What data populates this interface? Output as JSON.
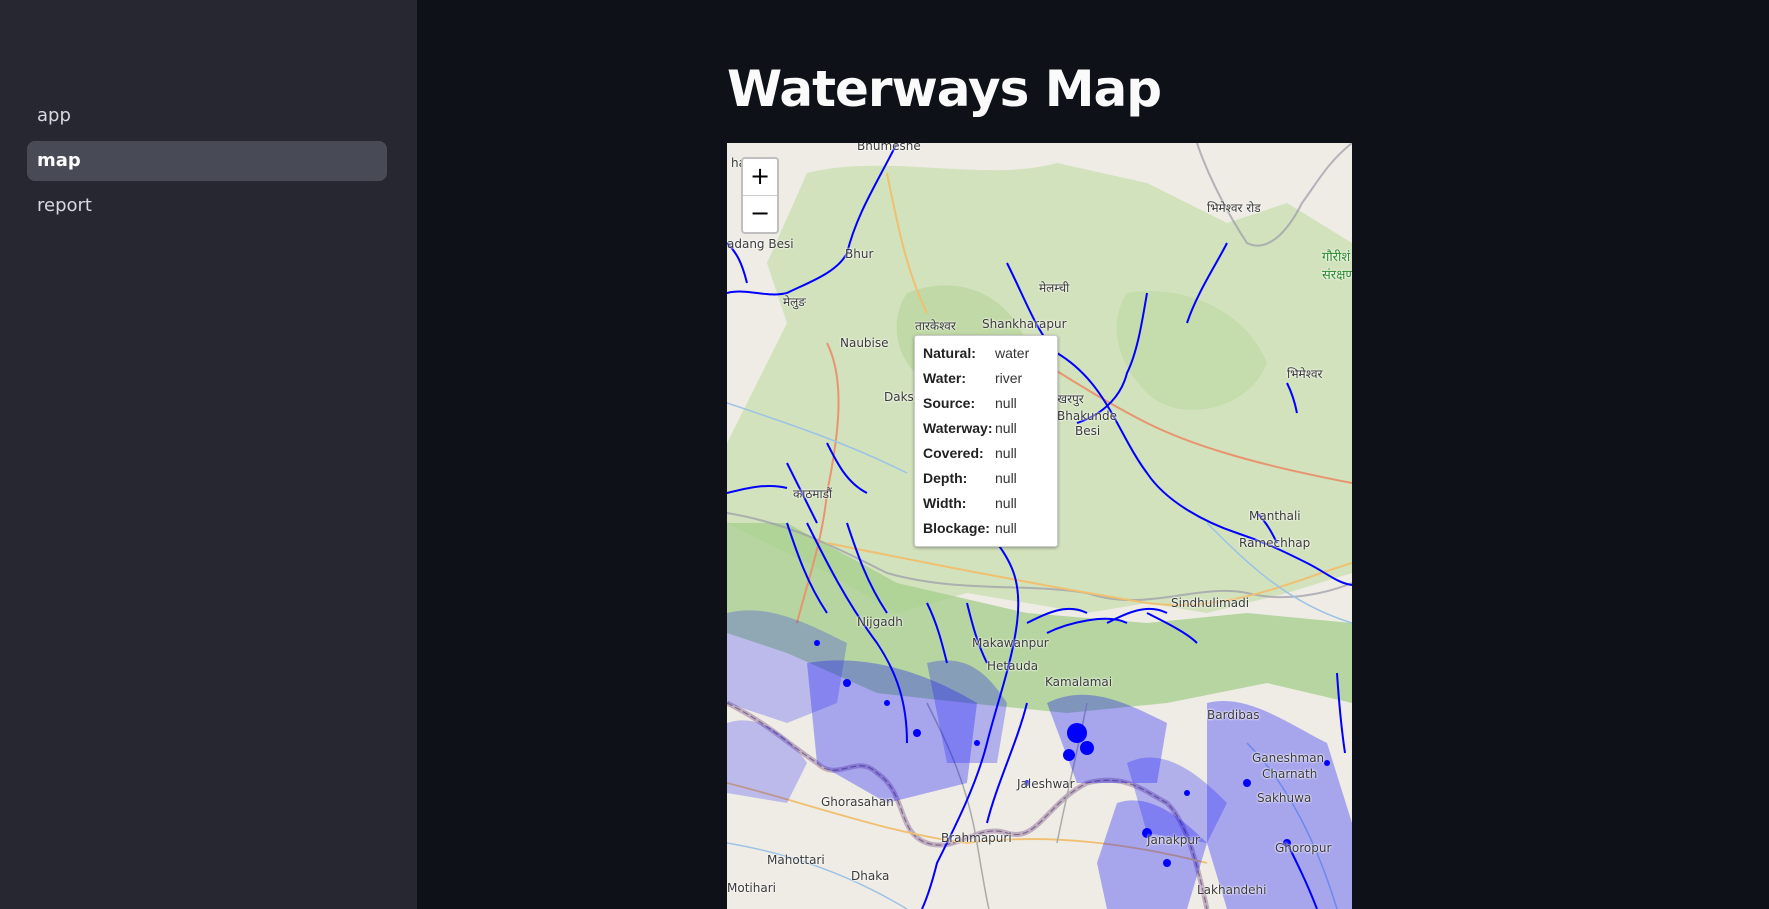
{
  "sidebar": {
    "items": [
      {
        "label": "app",
        "active": false
      },
      {
        "label": "map",
        "active": true
      },
      {
        "label": "report",
        "active": false
      }
    ]
  },
  "main": {
    "title": "Waterways Map"
  },
  "map": {
    "zoom_in_label": "+",
    "zoom_out_label": "−",
    "water_color": "#0000ff",
    "place_labels": [
      "harka",
      "Bhumeshe",
      "adang Besi",
      "Bhur",
      "मेलुङ",
      "मेलम्ची",
      "तारकेश्वर",
      "Shankharapur",
      "Naubise",
      "Daksh",
      "शिखरपुर",
      "Bhakunde",
      "Besi",
      "भिमेश्वर",
      "काठमाडौं",
      "Manthali",
      "Ramechhap",
      "Sindhulimadi",
      "Nijgadh",
      "Makawanpur",
      "Hetauda",
      "Kamalamai",
      "Bardibas",
      "Ghorasahan",
      "Ganeshman",
      "Charnath",
      "Jaleshwar",
      "Brahmapuri",
      "Dhaka",
      "Motihari",
      "Janakpur",
      "Sakhuwa",
      "Ghoropur",
      "गौरीशं",
      "संरक्षण",
      "भिमेश्वर रोड",
      "Mahottari",
      "Lakhandehi"
    ],
    "tooltip": [
      {
        "key": "Natural:",
        "value": "water"
      },
      {
        "key": "Water:",
        "value": "river"
      },
      {
        "key": "Source:",
        "value": "null"
      },
      {
        "key": "Waterway:",
        "value": "null"
      },
      {
        "key": "Covered:",
        "value": "null"
      },
      {
        "key": "Depth:",
        "value": "null"
      },
      {
        "key": "Width:",
        "value": "null"
      },
      {
        "key": "Blockage:",
        "value": "null"
      }
    ]
  }
}
